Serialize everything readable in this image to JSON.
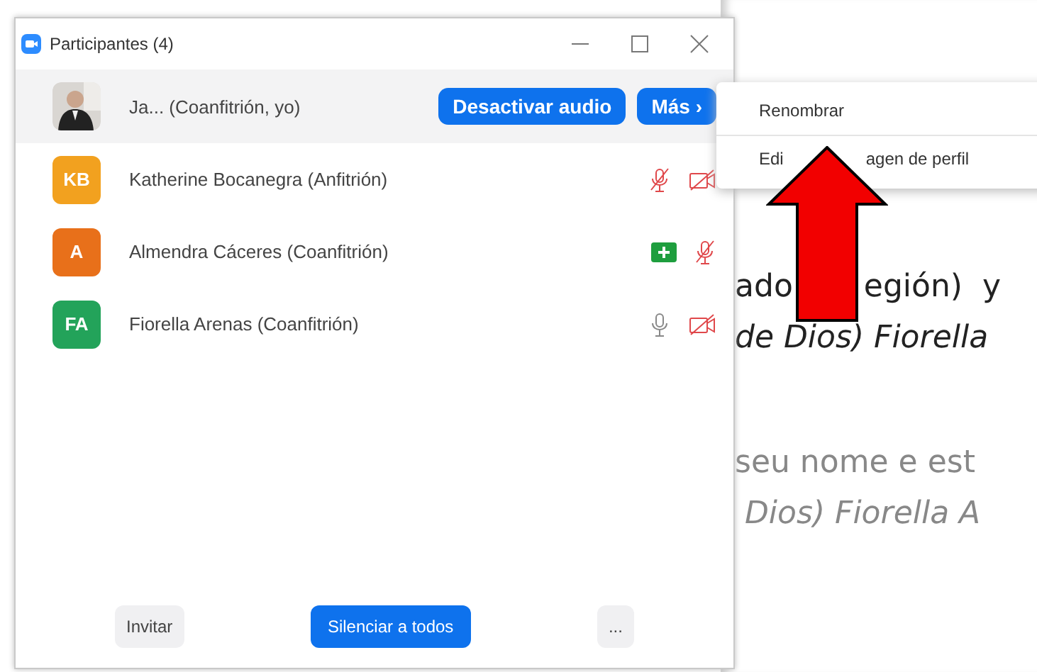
{
  "window": {
    "title": "Participantes (4)"
  },
  "participants": [
    {
      "name": "Ja... (Coanfitrión, yo)",
      "avatar": {
        "kind": "picture"
      },
      "selected": true,
      "buttons": [
        "Desactivar audio",
        "Más ›"
      ]
    },
    {
      "name": "Katherine Bocanegra (Anfitrión)",
      "avatar": {
        "kind": "initials",
        "text": "KB",
        "color": "#f2a11f"
      },
      "selected": false,
      "icons": [
        {
          "kind": "mic_muted"
        },
        {
          "kind": "video_off"
        }
      ]
    },
    {
      "name": "Almendra Cáceres (Coanfitrión)",
      "avatar": {
        "kind": "initials",
        "text": "A",
        "color": "#e8701a"
      },
      "selected": false,
      "icons": [
        {
          "kind": "screen_share"
        },
        {
          "kind": "mic_muted"
        }
      ]
    },
    {
      "name": "Fiorella Arenas (Coanfitrión)",
      "avatar": {
        "kind": "initials",
        "text": "FA",
        "color": "#23a35a"
      },
      "selected": false,
      "icons": [
        {
          "kind": "mic"
        },
        {
          "kind": "video_off"
        }
      ]
    }
  ],
  "footer_buttons": [
    {
      "label": "Invitar",
      "kind": "plain"
    },
    {
      "label": "Silenciar a todos",
      "kind": "primary"
    },
    {
      "label": "...",
      "kind": "plain"
    }
  ],
  "menu": {
    "items": [
      {
        "segments": [
          "Renombrar"
        ]
      },
      {
        "segments": [
          "Edi",
          "agen de perfil"
        ]
      }
    ]
  },
  "document_lines": [
    {
      "segments": [
        "ado",
        "egión)  y"
      ],
      "kind": "normal"
    },
    {
      "segments": [
        "de Dios) Fiorella"
      ],
      "kind": "italic"
    },
    {
      "segments": [
        "seu nome e est"
      ],
      "kind": "faded"
    },
    {
      "segments": [
        " Dios) Fiorella A"
      ],
      "kind": "faded_italic"
    }
  ]
}
